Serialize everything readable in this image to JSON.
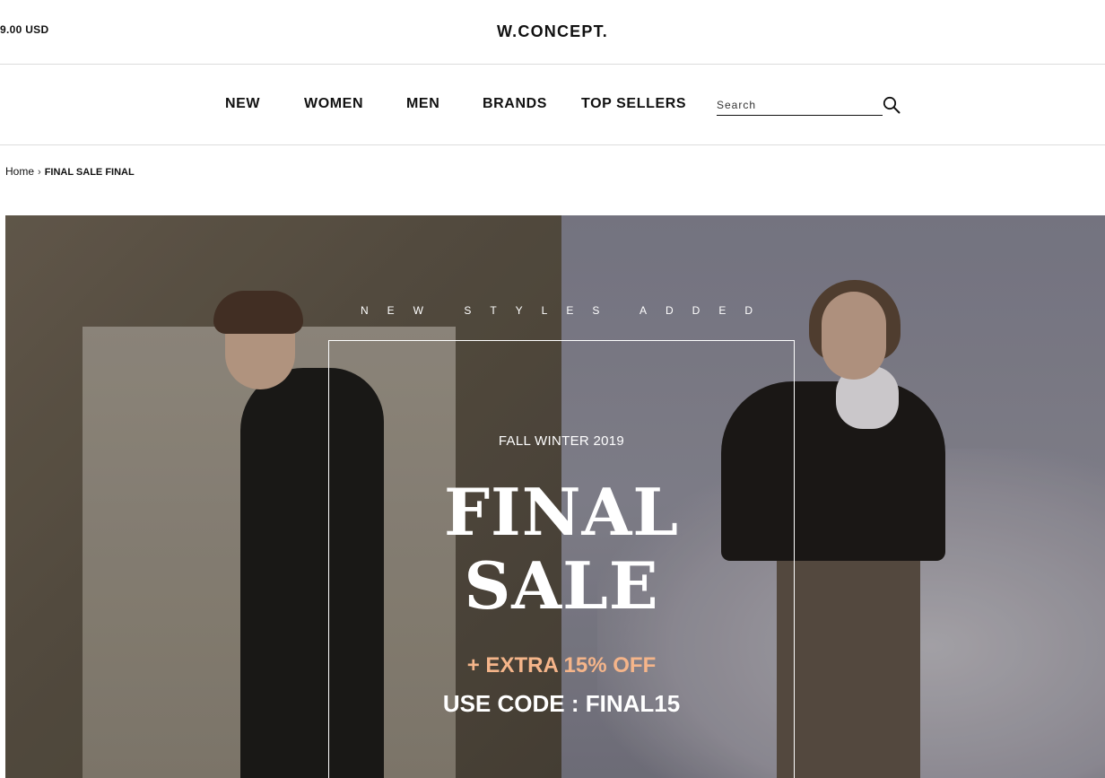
{
  "header": {
    "currency": "9.00 USD",
    "logo": "W.CONCEPT."
  },
  "nav": {
    "items": [
      {
        "label": "NEW"
      },
      {
        "label": "WOMEN"
      },
      {
        "label": "MEN"
      },
      {
        "label": "BRANDS"
      },
      {
        "label": "TOP SELLERS"
      }
    ],
    "search": {
      "placeholder": "Search",
      "value": "",
      "icon": "search-icon"
    }
  },
  "breadcrumb": {
    "home": "Home",
    "separator": "›",
    "current": "FINAL SALE FINAL"
  },
  "hero": {
    "tagline": "NEW STYLES ADDED",
    "season": "FALL WINTER 2019",
    "headline_line1": "FINAL",
    "headline_line2": "SALE",
    "extra_offer": "+ EXTRA 15% OFF",
    "promo_code": "USE CODE : FINAL15",
    "colors": {
      "accent": "#f5b58a",
      "text": "#ffffff"
    }
  }
}
